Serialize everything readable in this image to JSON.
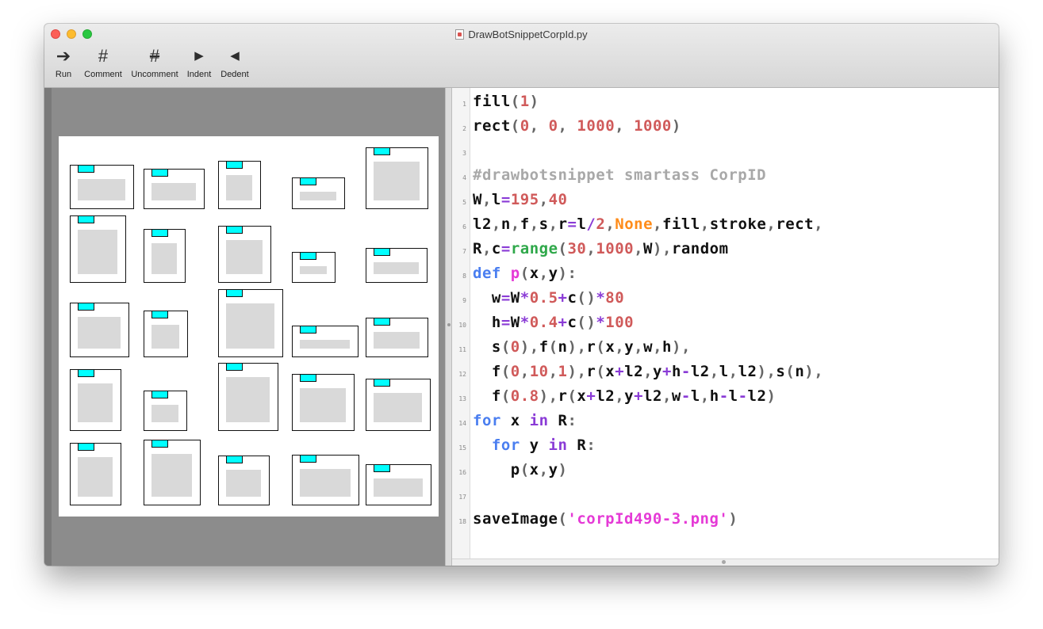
{
  "window": {
    "title": "DrawBotSnippetCorpId.py"
  },
  "toolbar": {
    "items": [
      {
        "label": "Run",
        "icon": "run-arrow-icon",
        "glyph": "➔"
      },
      {
        "label": "Comment",
        "icon": "hash-icon",
        "glyph": "#"
      },
      {
        "label": "Uncomment",
        "icon": "uncomment-hash-icon",
        "glyph": "#"
      },
      {
        "label": "Indent",
        "icon": "indent-icon",
        "glyph": "▶"
      },
      {
        "label": "Dedent",
        "icon": "dedent-icon",
        "glyph": "◀"
      }
    ]
  },
  "colors": {
    "canvas_tab": "#00ffff",
    "canvas_block": "#d9d9d9",
    "number": "#d05a5a",
    "string": "#e53ad6",
    "keyword": "#4a7ef0",
    "operator": "#8a3bd6",
    "comment": "#a8a8a8",
    "none_literal": "#ff8c1a",
    "builtin": "#2fa84a"
  },
  "editor": {
    "lines": [
      {
        "n": "1",
        "tokens": [
          [
            "fill",
            "plain"
          ],
          [
            "(",
            "pun"
          ],
          [
            "1",
            "num"
          ],
          [
            ")",
            "pun"
          ]
        ]
      },
      {
        "n": "2",
        "tokens": [
          [
            "rect",
            "plain"
          ],
          [
            "(",
            "pun"
          ],
          [
            "0",
            "num"
          ],
          [
            ", ",
            "pun"
          ],
          [
            "0",
            "num"
          ],
          [
            ", ",
            "pun"
          ],
          [
            "1000",
            "num"
          ],
          [
            ", ",
            "pun"
          ],
          [
            "1000",
            "num"
          ],
          [
            ")",
            "pun"
          ]
        ]
      },
      {
        "n": "3",
        "tokens": []
      },
      {
        "n": "4",
        "tokens": [
          [
            "#drawbotsnippet smartass CorpID",
            "com"
          ]
        ]
      },
      {
        "n": "5",
        "tokens": [
          [
            "W",
            "plain"
          ],
          [
            ",",
            "pun"
          ],
          [
            "l",
            "plain"
          ],
          [
            "=",
            "op"
          ],
          [
            "195",
            "num"
          ],
          [
            ",",
            "pun"
          ],
          [
            "40",
            "num"
          ]
        ]
      },
      {
        "n": "6",
        "tokens": [
          [
            "l2",
            "plain"
          ],
          [
            ",",
            "pun"
          ],
          [
            "n",
            "plain"
          ],
          [
            ",",
            "pun"
          ],
          [
            "f",
            "plain"
          ],
          [
            ",",
            "pun"
          ],
          [
            "s",
            "plain"
          ],
          [
            ",",
            "pun"
          ],
          [
            "r",
            "plain"
          ],
          [
            "=",
            "op"
          ],
          [
            "l",
            "plain"
          ],
          [
            "/",
            "op"
          ],
          [
            "2",
            "num"
          ],
          [
            ",",
            "pun"
          ],
          [
            "None",
            "none"
          ],
          [
            ",",
            "pun"
          ],
          [
            "fill",
            "plain"
          ],
          [
            ",",
            "pun"
          ],
          [
            "stroke",
            "plain"
          ],
          [
            ",",
            "pun"
          ],
          [
            "rect",
            "plain"
          ],
          [
            ",",
            "pun"
          ]
        ]
      },
      {
        "n": "7",
        "tokens": [
          [
            "R",
            "plain"
          ],
          [
            ",",
            "pun"
          ],
          [
            "c",
            "plain"
          ],
          [
            "=",
            "op"
          ],
          [
            "range",
            "bi"
          ],
          [
            "(",
            "pun"
          ],
          [
            "30",
            "num"
          ],
          [
            ",",
            "pun"
          ],
          [
            "1000",
            "num"
          ],
          [
            ",",
            "pun"
          ],
          [
            "W",
            "plain"
          ],
          [
            ")",
            "pun"
          ],
          [
            ",",
            "pun"
          ],
          [
            "random",
            "plain"
          ]
        ]
      },
      {
        "n": "8",
        "tokens": [
          [
            "def",
            "kw"
          ],
          [
            " ",
            "plain"
          ],
          [
            "p",
            "def"
          ],
          [
            "(",
            "pun"
          ],
          [
            "x",
            "plain"
          ],
          [
            ",",
            "pun"
          ],
          [
            "y",
            "plain"
          ],
          [
            ")",
            "pun"
          ],
          [
            ":",
            "pun"
          ]
        ]
      },
      {
        "n": "9",
        "tokens": [
          [
            "  w",
            "plain"
          ],
          [
            "=",
            "op"
          ],
          [
            "W",
            "plain"
          ],
          [
            "*",
            "op"
          ],
          [
            "0.5",
            "num"
          ],
          [
            "+",
            "op"
          ],
          [
            "c",
            "plain"
          ],
          [
            "()",
            "pun"
          ],
          [
            "*",
            "op"
          ],
          [
            "80",
            "num"
          ]
        ]
      },
      {
        "n": "10",
        "tokens": [
          [
            "  h",
            "plain"
          ],
          [
            "=",
            "op"
          ],
          [
            "W",
            "plain"
          ],
          [
            "*",
            "op"
          ],
          [
            "0.4",
            "num"
          ],
          [
            "+",
            "op"
          ],
          [
            "c",
            "plain"
          ],
          [
            "()",
            "pun"
          ],
          [
            "*",
            "op"
          ],
          [
            "100",
            "num"
          ]
        ]
      },
      {
        "n": "11",
        "tokens": [
          [
            "  s",
            "plain"
          ],
          [
            "(",
            "pun"
          ],
          [
            "0",
            "num"
          ],
          [
            ")",
            "pun"
          ],
          [
            ",",
            "pun"
          ],
          [
            "f",
            "plain"
          ],
          [
            "(",
            "pun"
          ],
          [
            "n",
            "plain"
          ],
          [
            ")",
            "pun"
          ],
          [
            ",",
            "pun"
          ],
          [
            "r",
            "plain"
          ],
          [
            "(",
            "pun"
          ],
          [
            "x",
            "plain"
          ],
          [
            ",",
            "pun"
          ],
          [
            "y",
            "plain"
          ],
          [
            ",",
            "pun"
          ],
          [
            "w",
            "plain"
          ],
          [
            ",",
            "pun"
          ],
          [
            "h",
            "plain"
          ],
          [
            ")",
            "pun"
          ],
          [
            ",",
            "pun"
          ]
        ]
      },
      {
        "n": "12",
        "tokens": [
          [
            "  f",
            "plain"
          ],
          [
            "(",
            "pun"
          ],
          [
            "0",
            "num"
          ],
          [
            ",",
            "pun"
          ],
          [
            "10",
            "num"
          ],
          [
            ",",
            "pun"
          ],
          [
            "1",
            "num"
          ],
          [
            ")",
            "pun"
          ],
          [
            ",",
            "pun"
          ],
          [
            "r",
            "plain"
          ],
          [
            "(",
            "pun"
          ],
          [
            "x",
            "plain"
          ],
          [
            "+",
            "op"
          ],
          [
            "l2",
            "plain"
          ],
          [
            ",",
            "pun"
          ],
          [
            "y",
            "plain"
          ],
          [
            "+",
            "op"
          ],
          [
            "h",
            "plain"
          ],
          [
            "-",
            "op"
          ],
          [
            "l2",
            "plain"
          ],
          [
            ",",
            "pun"
          ],
          [
            "l",
            "plain"
          ],
          [
            ",",
            "pun"
          ],
          [
            "l2",
            "plain"
          ],
          [
            ")",
            "pun"
          ],
          [
            ",",
            "pun"
          ],
          [
            "s",
            "plain"
          ],
          [
            "(",
            "pun"
          ],
          [
            "n",
            "plain"
          ],
          [
            ")",
            "pun"
          ],
          [
            ",",
            "pun"
          ]
        ]
      },
      {
        "n": "13",
        "tokens": [
          [
            "  f",
            "plain"
          ],
          [
            "(",
            "pun"
          ],
          [
            "0.8",
            "num"
          ],
          [
            ")",
            "pun"
          ],
          [
            ",",
            "pun"
          ],
          [
            "r",
            "plain"
          ],
          [
            "(",
            "pun"
          ],
          [
            "x",
            "plain"
          ],
          [
            "+",
            "op"
          ],
          [
            "l2",
            "plain"
          ],
          [
            ",",
            "pun"
          ],
          [
            "y",
            "plain"
          ],
          [
            "+",
            "op"
          ],
          [
            "l2",
            "plain"
          ],
          [
            ",",
            "pun"
          ],
          [
            "w",
            "plain"
          ],
          [
            "-",
            "op"
          ],
          [
            "l",
            "plain"
          ],
          [
            ",",
            "pun"
          ],
          [
            "h",
            "plain"
          ],
          [
            "-",
            "op"
          ],
          [
            "l",
            "plain"
          ],
          [
            "-",
            "op"
          ],
          [
            "l2",
            "plain"
          ],
          [
            ")",
            "pun"
          ]
        ]
      },
      {
        "n": "14",
        "tokens": [
          [
            "for",
            "kw"
          ],
          [
            " x ",
            "plain"
          ],
          [
            "in",
            "op"
          ],
          [
            " R",
            "plain"
          ],
          [
            ":",
            "pun"
          ]
        ]
      },
      {
        "n": "15",
        "tokens": [
          [
            "  for",
            "kw"
          ],
          [
            " y ",
            "plain"
          ],
          [
            "in",
            "op"
          ],
          [
            " R",
            "plain"
          ],
          [
            ":",
            "pun"
          ]
        ]
      },
      {
        "n": "16",
        "tokens": [
          [
            "    p",
            "plain"
          ],
          [
            "(",
            "pun"
          ],
          [
            "x",
            "plain"
          ],
          [
            ",",
            "pun"
          ],
          [
            "y",
            "plain"
          ],
          [
            ")",
            "pun"
          ]
        ]
      },
      {
        "n": "17",
        "tokens": []
      },
      {
        "n": "18",
        "tokens": [
          [
            "saveImage",
            "plain"
          ],
          [
            "(",
            "pun"
          ],
          [
            "'corpId490-3.png'",
            "str"
          ],
          [
            ")",
            "pun"
          ]
        ]
      }
    ]
  }
}
